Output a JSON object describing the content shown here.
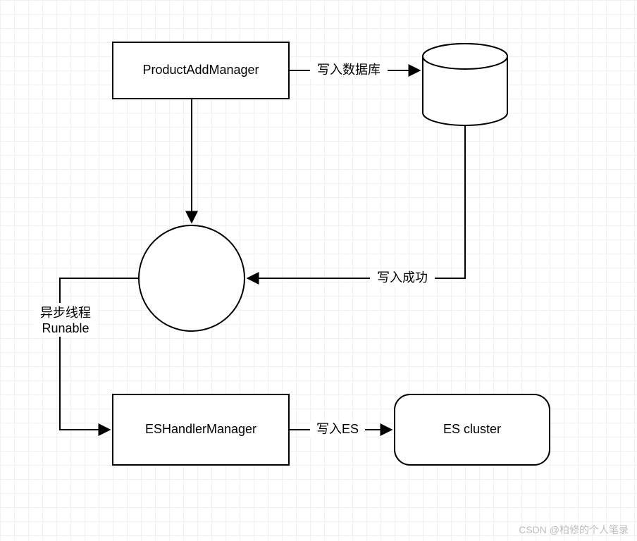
{
  "nodes": {
    "productAddManager": {
      "label": "ProductAddManager"
    },
    "esHandlerManager": {
      "label": "ESHandlerManager"
    },
    "esCluster": {
      "label": "ES cluster"
    }
  },
  "edges": {
    "writeDb": {
      "label": "写入数据库"
    },
    "writeSuccess": {
      "label": "写入成功"
    },
    "asyncRunnable": {
      "line1": "异步线程",
      "line2": "Runable"
    },
    "writeEs": {
      "label": "写入ES"
    }
  },
  "watermark": "CSDN @柏修的个人笔录"
}
